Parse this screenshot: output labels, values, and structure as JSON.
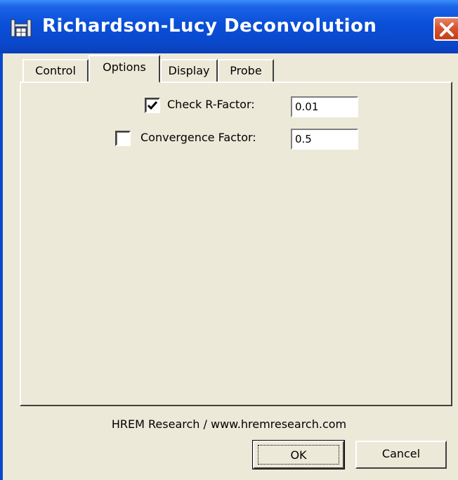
{
  "window": {
    "title": "Richardson-Lucy Deconvolution",
    "title_icon": "hrem-app-icon",
    "close_icon": "close-icon"
  },
  "tabs": [
    {
      "label": "Control",
      "active": false
    },
    {
      "label": "Options",
      "active": true
    },
    {
      "label": "Display",
      "active": false
    },
    {
      "label": "Probe",
      "active": false
    }
  ],
  "options": {
    "check_r_factor": {
      "label": "Check R-Factor:",
      "checked": true,
      "value": "0.01"
    },
    "convergence_factor": {
      "label": "Convergence Factor:",
      "checked": false,
      "value": "0.5"
    }
  },
  "footer": {
    "credit": "HREM Research / www.hremresearch.com"
  },
  "buttons": {
    "ok_label": "OK",
    "cancel_label": "Cancel"
  },
  "colors": {
    "titlebar": "#0a48cc",
    "dialog_bg": "#ece9d8",
    "close_button": "#c5401b"
  }
}
